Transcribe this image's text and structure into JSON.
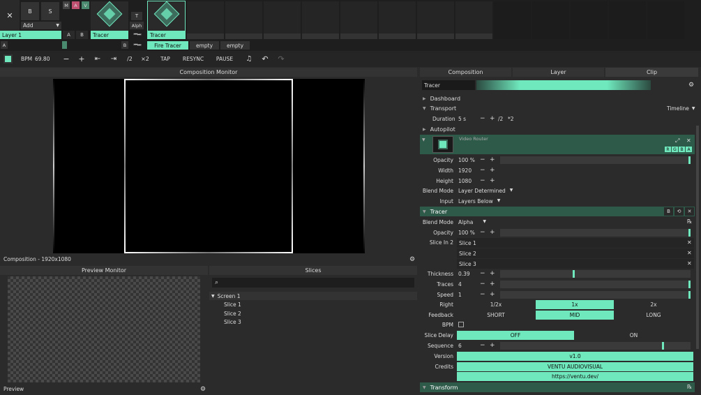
{
  "layer": {
    "close": "✕",
    "b": "B",
    "s": "S",
    "blend": "Add",
    "name": "Layer 1",
    "a": "A",
    "b2": "B",
    "m": "M",
    "ma": "A",
    "v": "V",
    "t": "T",
    "alph": "Alph"
  },
  "clips": [
    {
      "name": "Tracer"
    },
    {
      "name": "Tracer"
    }
  ],
  "deck": {
    "a_label": "A",
    "b_label": "B",
    "tabs": [
      "Fire Tracer",
      "empty",
      "empty"
    ]
  },
  "toolbar": {
    "bpm_label": "BPM",
    "bpm_value": "69.80",
    "minus": "−",
    "plus": "+",
    "nudge_left": "⇤",
    "nudge_right": "⇥",
    "half": "/2",
    "double": "×2",
    "tap": "TAP",
    "resync": "RESYNC",
    "pause": "PAUSE"
  },
  "comp_monitor": {
    "title": "Composition Monitor",
    "footer": "Composition - 1920x1080"
  },
  "preview": {
    "title": "Preview Monitor",
    "footer": "Preview"
  },
  "slices": {
    "title": "Slices",
    "screen": "Screen 1",
    "items": [
      "Slice 1",
      "Slice 2",
      "Slice 3"
    ]
  },
  "panel": {
    "tabs": [
      "Composition",
      "Layer",
      "Clip"
    ],
    "clip_name": "Tracer",
    "dashboard": "Dashboard",
    "transport": "Transport",
    "timeline": "Timeline",
    "duration_label": "Duration",
    "duration_value": "5 s",
    "half": "/2",
    "double": "*2",
    "autopilot": "Autopilot",
    "video_router": "Video Router",
    "rgba": [
      "R",
      "G",
      "B",
      "A"
    ],
    "vr_rows": [
      {
        "label": "Opacity",
        "value": "100 %"
      },
      {
        "label": "Width",
        "value": "1920"
      },
      {
        "label": "Height",
        "value": "1080"
      }
    ],
    "vr_blend_label": "Blend Mode",
    "vr_blend_value": "Layer Determined",
    "input_label": "Input",
    "input_value": "Layers Below",
    "tracer_title": "Tracer",
    "tracer_b": "B",
    "tracer_blend_label": "Blend Mode",
    "tracer_blend_value": "Alpha",
    "tracer_opacity_label": "Opacity",
    "tracer_opacity_value": "100 %",
    "slice_in_label": "Slice In 2",
    "slice_in_items": [
      "Slice 1",
      "Slice 2",
      "Slice 3"
    ],
    "thickness_label": "Thickness",
    "thickness_value": "0.39",
    "thickness_level": 0.39,
    "traces_label": "Traces",
    "traces_value": "4",
    "speed_label": "Speed",
    "speed_value": "1",
    "right_label": "Right",
    "right_options": [
      "1/2x",
      "1x",
      "2x"
    ],
    "feedback_label": "Feedback",
    "feedback_options": [
      "SHORT",
      "MID",
      "LONG"
    ],
    "bpm_label": "BPM",
    "slice_delay_label": "Slice Delay",
    "slice_delay_options": [
      "OFF",
      "ON"
    ],
    "sequence_label": "Sequence",
    "sequence_value": "6",
    "version_label": "Version",
    "version_value": "v1.0",
    "credits_label": "Credits",
    "credits_value": "VENTU AUDIOVISUAL",
    "url_value": "https://ventu.dev/",
    "transform": "Transform"
  },
  "colors": {
    "accent": "#6fe8bd",
    "header_green": "#2e5a4a"
  }
}
